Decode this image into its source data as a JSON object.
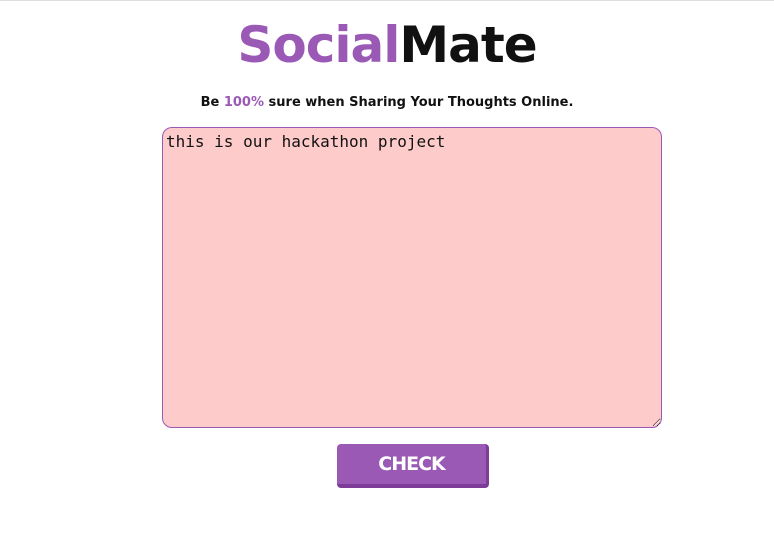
{
  "header": {
    "logo_part1": "Social",
    "logo_part2": "Mate",
    "tagline_prefix": "Be ",
    "tagline_highlight": "100%",
    "tagline_suffix": " sure when Sharing Your Thoughts Online."
  },
  "editor": {
    "value": "this is our hackathon project"
  },
  "actions": {
    "check_label": "CHECK"
  },
  "colors": {
    "brand_purple": "#9b59b6",
    "textarea_bg": "#fecbcb",
    "text_dark": "#111111"
  }
}
